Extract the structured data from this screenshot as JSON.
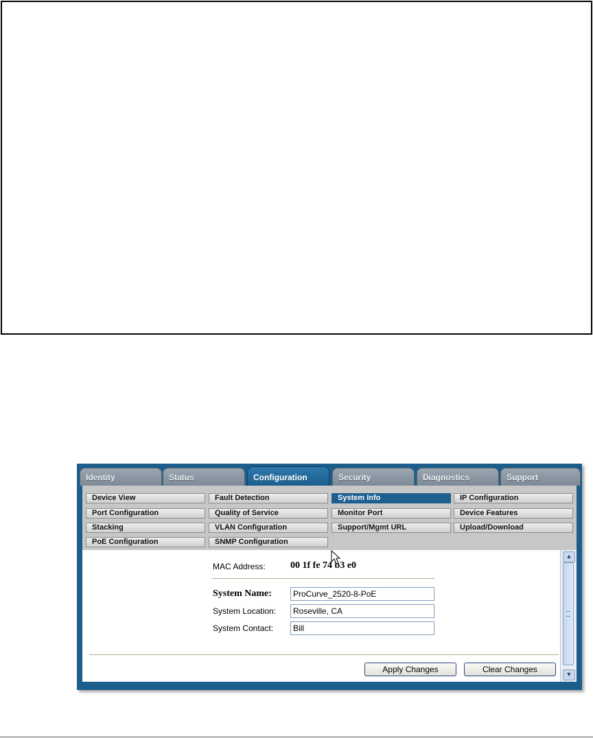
{
  "tabs": [
    {
      "label": "Identity",
      "active": false
    },
    {
      "label": "Status",
      "active": false
    },
    {
      "label": "Configuration",
      "active": true
    },
    {
      "label": "Security",
      "active": false
    },
    {
      "label": "Diagnostics",
      "active": false
    },
    {
      "label": "Support",
      "active": false
    }
  ],
  "menu": {
    "device_view": "Device View",
    "fault_detection": "Fault Detection",
    "system_info": "System Info",
    "ip_configuration": "IP Configuration",
    "port_configuration": "Port Configuration",
    "quality_of_service": "Quality of Service",
    "monitor_port": "Monitor Port",
    "device_features": "Device Features",
    "stacking": "Stacking",
    "vlan_configuration": "VLAN Configuration",
    "support_mgmt_url": "Support/Mgmt URL",
    "upload_download": "Upload/Download",
    "poe_configuration": "PoE Configuration",
    "snmp_configuration": "SNMP Configuration",
    "active_item": "System Info"
  },
  "system_info": {
    "mac_label": "MAC Address:",
    "mac_value": "00 1f fe 74 b3 e0",
    "name_label": "System Name:",
    "name_value": "ProCurve_2520-8-PoE",
    "location_label": "System Location:",
    "location_value": "Roseville, CA",
    "contact_label": "System Contact:",
    "contact_value": "Bill"
  },
  "buttons": {
    "apply": "Apply Changes",
    "clear": "Clear Changes"
  },
  "icons": {
    "scroll_up": "chevron-up-icon",
    "scroll_down": "chevron-down-icon",
    "cursor": "mouse-pointer-icon"
  },
  "colors": {
    "frame_blue": "#1b5e8c",
    "active_menu": "#1f5f8f",
    "menu_panel": "#c7c7c7",
    "inactive_tab": "#8a96a1"
  }
}
